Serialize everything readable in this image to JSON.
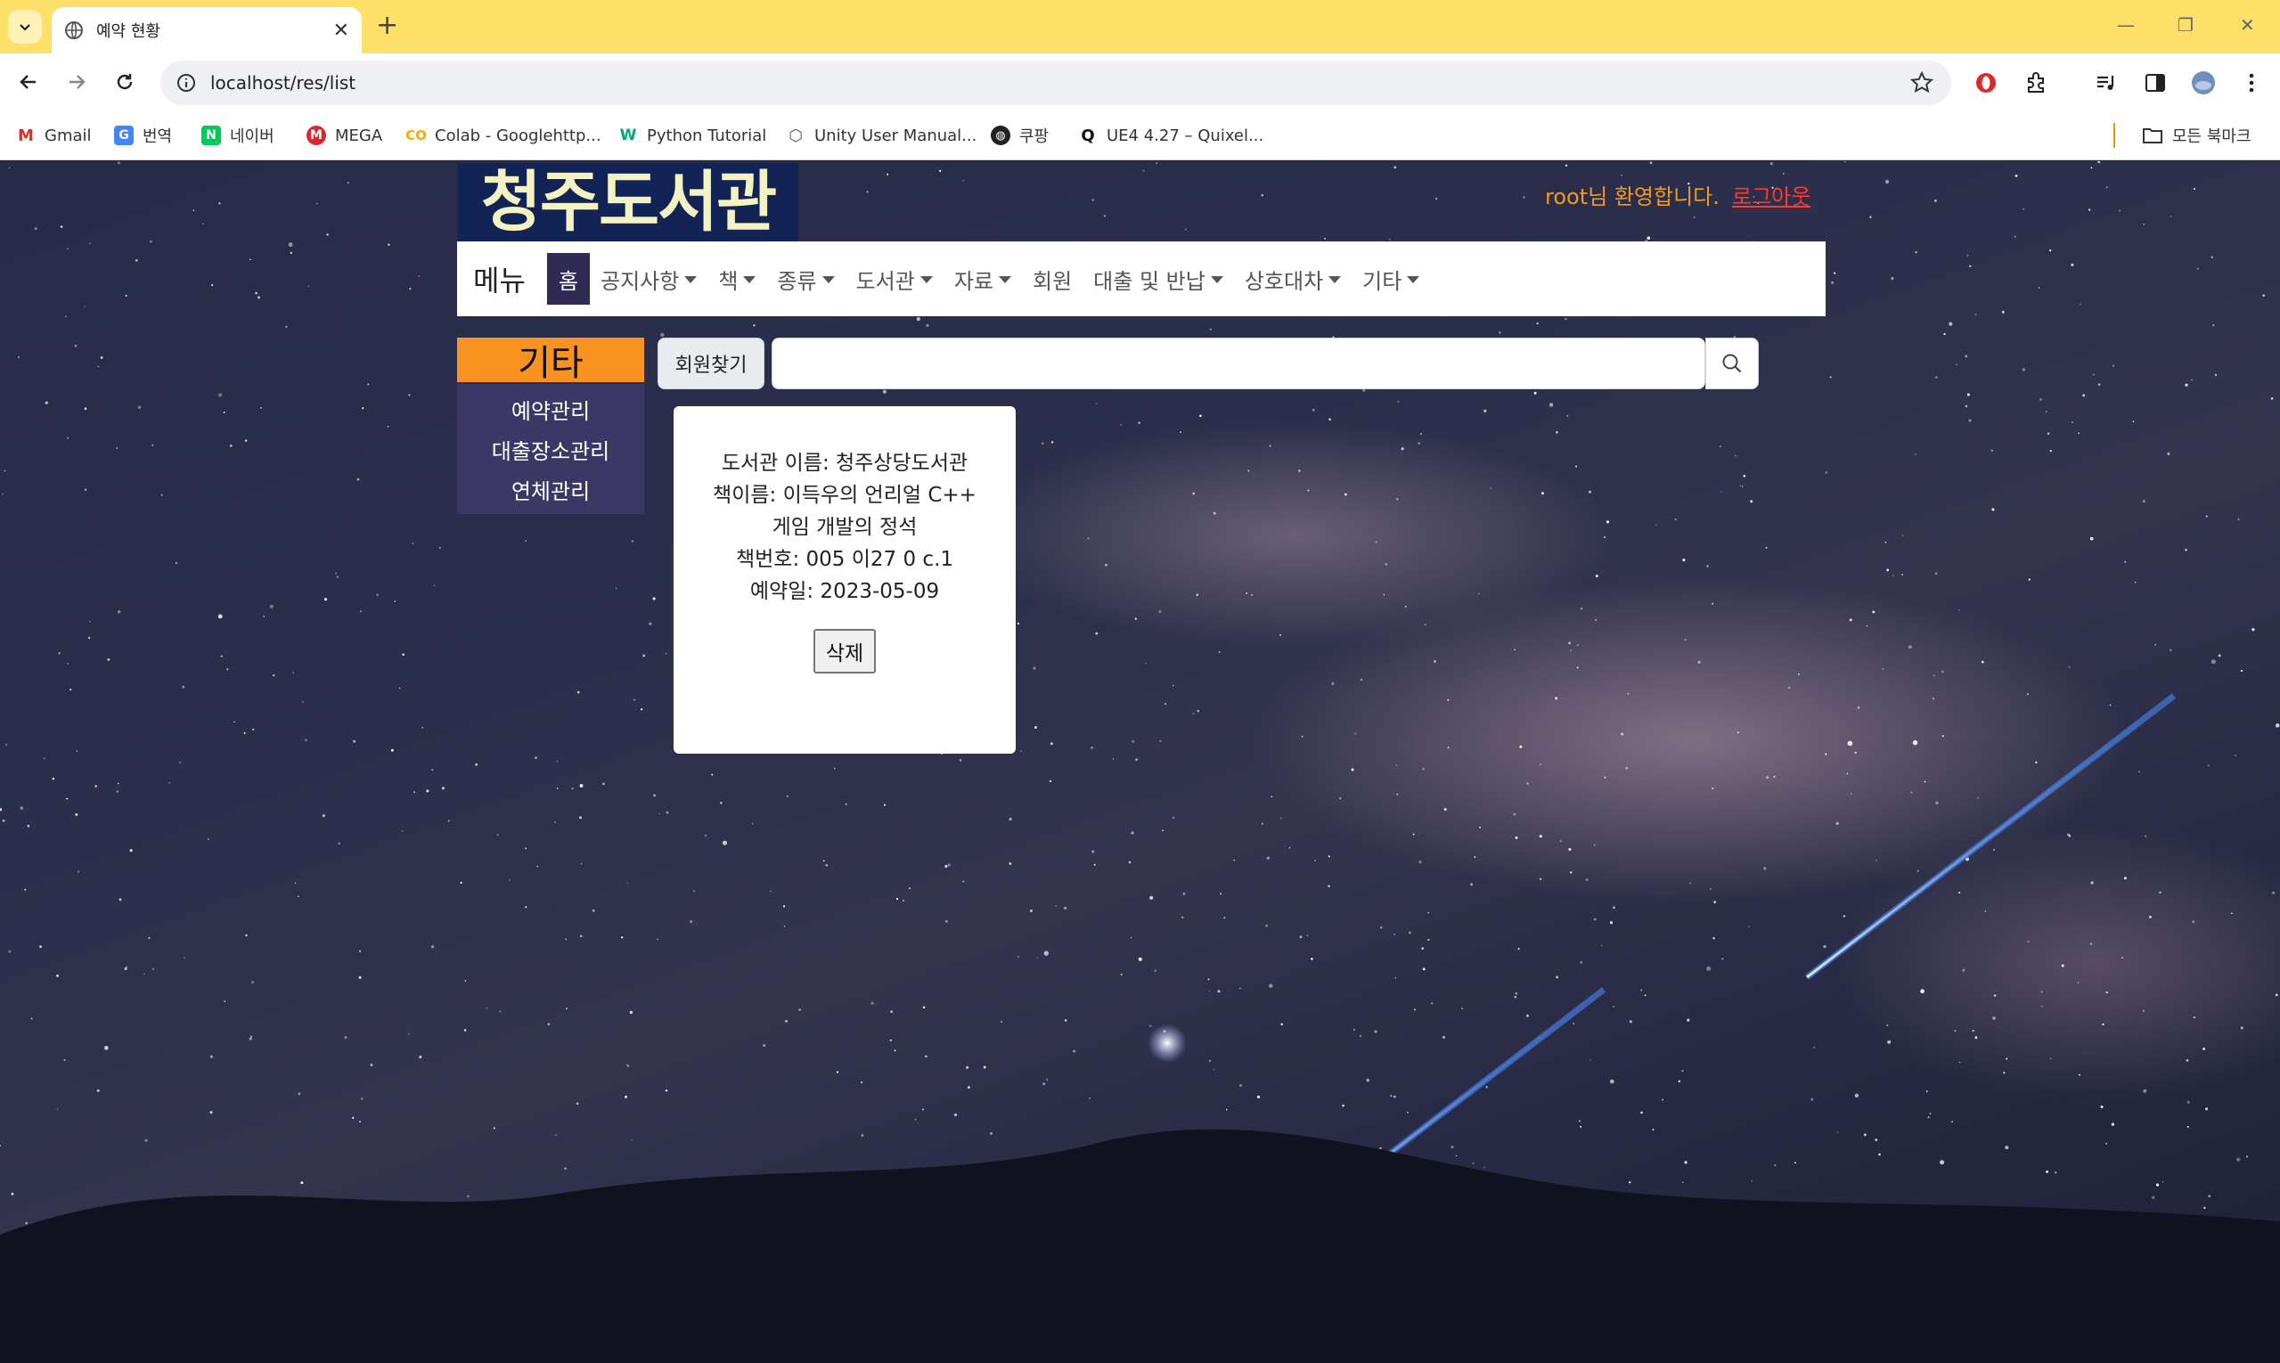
{
  "browser": {
    "tab_title": "예약 현황",
    "url": "localhost/res/list",
    "bookmarks": [
      {
        "label": "Gmail",
        "icon": "gmail-icon"
      },
      {
        "label": "번역",
        "icon": "translate-icon"
      },
      {
        "label": "네이버",
        "icon": "naver-icon"
      },
      {
        "label": "MEGA",
        "icon": "mega-icon"
      },
      {
        "label": "Colab - Googlehttp...",
        "icon": "colab-icon"
      },
      {
        "label": "Python Tutorial",
        "icon": "w3schools-icon"
      },
      {
        "label": "Unity User Manual...",
        "icon": "unity-icon"
      },
      {
        "label": "쿠팡",
        "icon": "globe-icon"
      },
      {
        "label": "UE4 4.27 – Quixel...",
        "icon": "quixel-icon"
      }
    ],
    "all_bookmarks": "모든 북마크"
  },
  "site": {
    "logo": "청주도서관",
    "welcome": "root님 환영합니다.",
    "logout": "로그아웃",
    "menu_label": "메뉴",
    "nav": [
      {
        "label": "홈",
        "dropdown": false,
        "active": true
      },
      {
        "label": "공지사항",
        "dropdown": true
      },
      {
        "label": "책",
        "dropdown": true
      },
      {
        "label": "종류",
        "dropdown": true
      },
      {
        "label": "도서관",
        "dropdown": true
      },
      {
        "label": "자료",
        "dropdown": true
      },
      {
        "label": "회원",
        "dropdown": false
      },
      {
        "label": "대출 및 반납",
        "dropdown": true
      },
      {
        "label": "상호대차",
        "dropdown": true
      },
      {
        "label": "기타",
        "dropdown": true
      }
    ],
    "sidebar": {
      "title": "기타",
      "items": [
        "예약관리",
        "대출장소관리",
        "연체관리"
      ]
    },
    "search": {
      "type_label": "회원찾기",
      "value": ""
    },
    "reservation": {
      "library": "도서관 이름: 청주상당도서관",
      "book": "책이름: 이득우의 언리얼 C++ 게임 개발의 정석",
      "call_number": "책번호: 005 이27 0 c.1",
      "date": "예약일: 2023-05-09",
      "delete_label": "삭제"
    }
  },
  "colors": {
    "tab_bar": "#fde06a",
    "logo_bg": "#122455",
    "sidebar_header": "#f7931e",
    "sidebar_bg": "#3c3866",
    "nav_active": "#2f2b55",
    "welcome_text": "#f29a1a",
    "logout_text": "#ff3b30"
  }
}
